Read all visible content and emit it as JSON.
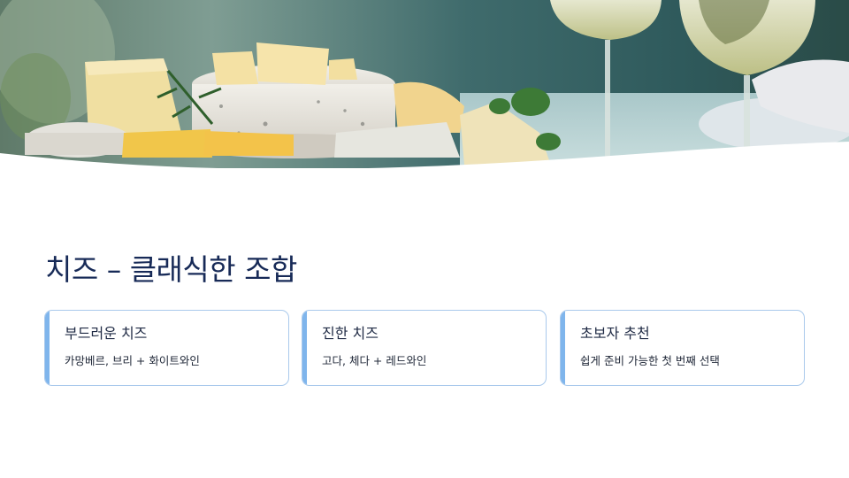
{
  "slide": {
    "title": "치즈 – 클래식한 조합"
  },
  "hero_image": {
    "description_icon": "cheese-wine-photo"
  },
  "cards": [
    {
      "title": "부드러운 치즈",
      "desc": "카망베르, 브리 + 화이트와인"
    },
    {
      "title": "진한 치즈",
      "desc": "고다, 체다 + 레드와인"
    },
    {
      "title": "초보자 추천",
      "desc": "쉽게 준비 가능한 첫 번째 선택"
    }
  ],
  "colors": {
    "title": "#172a57",
    "card_border": "#a9c9ec",
    "card_accent": "#7fb5ec"
  }
}
